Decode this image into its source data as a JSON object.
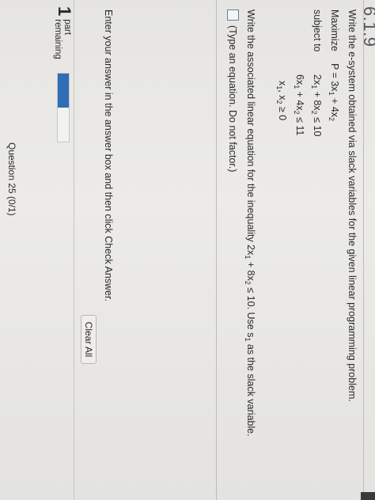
{
  "section_heading": "6.1.9",
  "prompt": "Write the e-system obtained via slack variables for the given linear programming problem.",
  "lp": {
    "maximize_label": "Maximize",
    "subject_to_label": "subject to",
    "objective": {
      "lhs": "P = 3x",
      "s1": "1",
      "mid": " + 4x",
      "s2": "2"
    },
    "constraint1": {
      "a": "2x",
      "s1": "1",
      "b": " + 8x",
      "s2": "2",
      "rel": " ≤ 10"
    },
    "constraint2": {
      "a": "6x",
      "s1": "1",
      "b": " + 4x",
      "s2": "2",
      "rel": " ≤ 11"
    },
    "nonneg": {
      "a": "x",
      "s1": "1",
      "b": ", x",
      "s2": "2",
      "rel": " ≥ 0"
    }
  },
  "instruction": {
    "pre": "Write the associated linear equation for the inequality 2x",
    "s1": "1",
    "mid": " + 8x",
    "s2": "2",
    "rel": " ≤ 10. Use s",
    "s3": "1",
    "post": " as the slack variable."
  },
  "answer_hint": "(Type an equation. Do not factor.)",
  "enter_message": "Enter your answer in the answer box and then click Check Answer.",
  "clear_all_label": "Clear All",
  "parts": {
    "count": "1",
    "line1": "part",
    "line2": "remaining"
  },
  "progress_fraction": 0.5,
  "question_label": "Question 25 (0/1)",
  "colors": {
    "progress": "#2f6db5",
    "answer_box_border": "#5b7fb3"
  }
}
